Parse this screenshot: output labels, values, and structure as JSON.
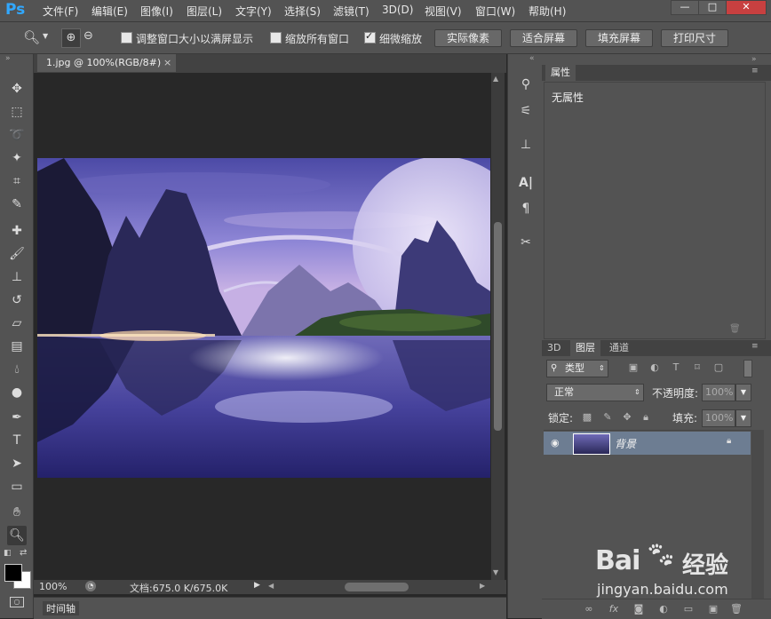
{
  "app": {
    "logo": "Ps"
  },
  "menu": [
    "文件(F)",
    "编辑(E)",
    "图像(I)",
    "图层(L)",
    "文字(Y)",
    "选择(S)",
    "滤镜(T)",
    "3D(D)",
    "视图(V)",
    "窗口(W)",
    "帮助(H)"
  ],
  "window_controls": {
    "minimize": "—",
    "maximize": "□",
    "close": "✕"
  },
  "options": {
    "resize_windows": "调整窗口大小以满屏显示",
    "resize_windows_checked": false,
    "zoom_all": "缩放所有窗口",
    "zoom_all_checked": false,
    "scrubby_zoom": "细微缩放",
    "scrubby_zoom_checked": true,
    "actual_pixels": "实际像素",
    "fit_screen": "适合屏幕",
    "fill_screen": "填充屏幕",
    "print_size": "打印尺寸"
  },
  "document": {
    "tab_title": "1.jpg @ 100%(RGB/8#)",
    "tab_close": "×",
    "zoom": "100%",
    "doc_info": "文档:675.0 K/675.0K"
  },
  "timeline": {
    "label": "时间轴"
  },
  "properties": {
    "tab": "属性",
    "empty_text": "无属性"
  },
  "layers_panel": {
    "tabs": [
      "3D",
      "图层",
      "通道"
    ],
    "filter_kind": "类型",
    "blend_mode": "正常",
    "opacity_label": "不透明度:",
    "opacity_value": "100%",
    "lock_label": "锁定:",
    "fill_label": "填充:",
    "fill_value": "100%",
    "layers": [
      {
        "name": "背景",
        "visible": true,
        "locked": true
      }
    ]
  },
  "watermark": {
    "brand": "Bai",
    "brand2": "经验",
    "url": "jingyan.baidu.com"
  },
  "colors": {
    "accent": "#31a8ff",
    "layer_selected": "#6d7d92"
  }
}
